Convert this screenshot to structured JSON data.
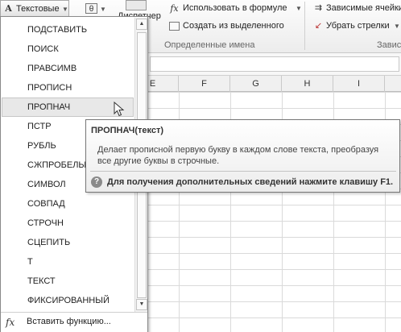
{
  "ribbon": {
    "func_button_label": "Текстовые",
    "func_button_icon": "text-A-icon",
    "math_icon": "theta-icon",
    "dispatcher_label": "Диспетчер",
    "use_in_formula": "Использовать в формуле",
    "create_from_selection": "Создать из выделенного",
    "defined_names_group": "Определенные имена",
    "dependent_cells": "Зависимые ячейки",
    "remove_arrows": "Убрать стрелки",
    "dependencies_group": "Завис"
  },
  "sheet": {
    "columns": [
      "E",
      "F",
      "G",
      "H",
      "I"
    ]
  },
  "dropdown": {
    "items": [
      "ПОДСТАВИТЬ",
      "ПОИСК",
      "ПРАВСИМВ",
      "ПРОПИСН",
      "ПРОПНАЧ",
      "ПСТР",
      "РУБЛЬ",
      "СЖПРОБЕЛЫ",
      "СИМВОЛ",
      "СОВПАД",
      "СТРОЧН",
      "СЦЕПИТЬ",
      "Т",
      "ТЕКСТ",
      "ФИКСИРОВАННЫЙ"
    ],
    "hovered_index": 4,
    "footer_icon": "fx-icon",
    "footer_label": "Вставить функцию..."
  },
  "tooltip": {
    "title": "ПРОПНАЧ(текст)",
    "description": "Делает прописной первую букву в каждом слове текста, преобразуя все другие буквы в строчные.",
    "help_icon": "help-icon",
    "help": "Для получения дополнительных сведений нажмите клавишу F1."
  }
}
